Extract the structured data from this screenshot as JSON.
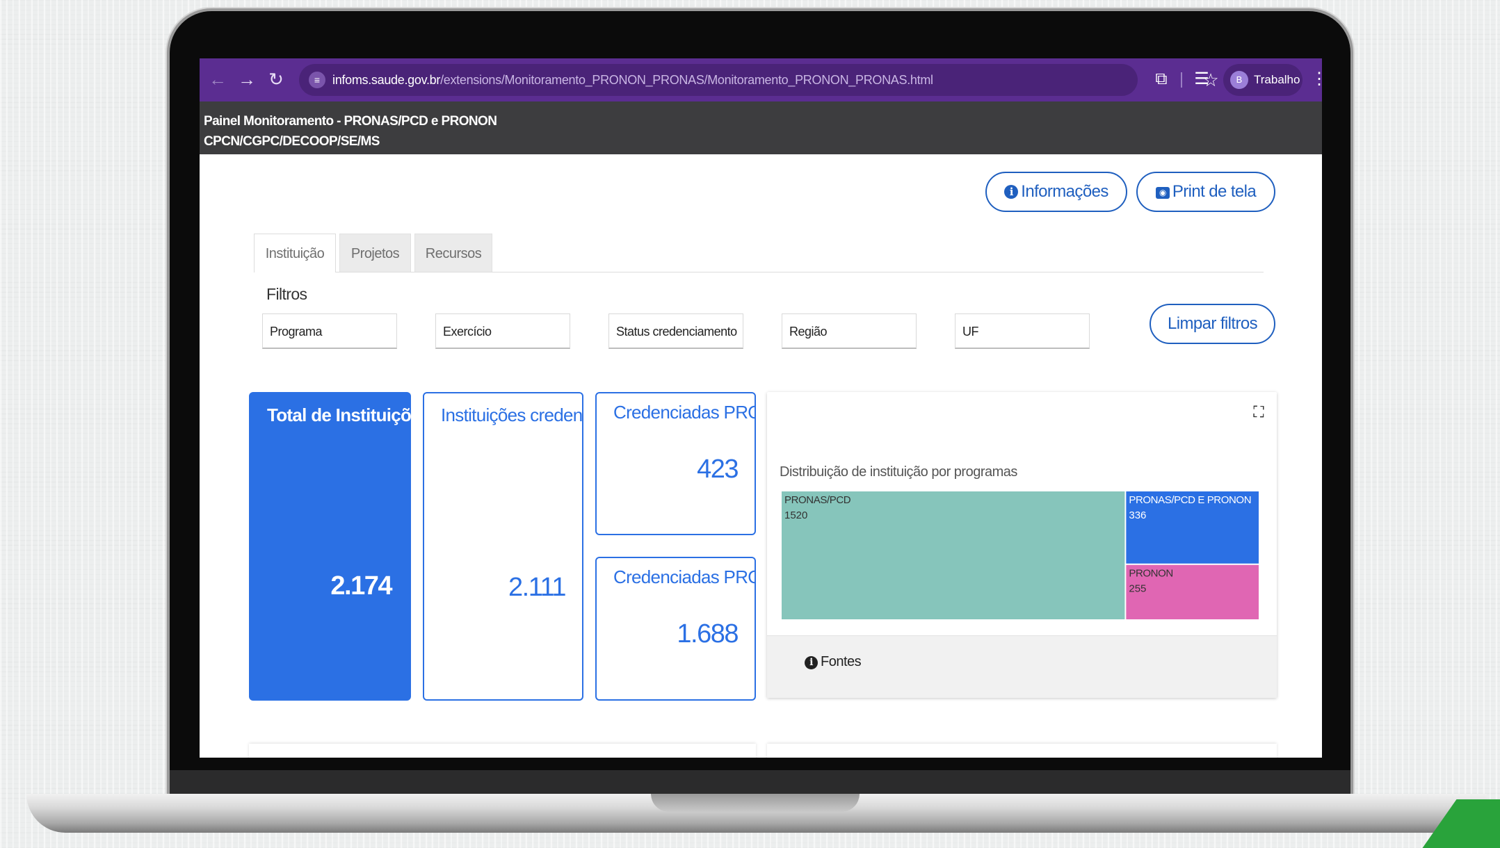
{
  "browser": {
    "url_host": "infoms.saude.gov.br",
    "url_path": "/extensions/Monitoramento_PRONON_PRONAS/Monitoramento_PRONON_PRONAS.html",
    "profile_initial": "B",
    "profile_name": "Trabalho"
  },
  "header": {
    "title": "Painel Monitoramento - PRONAS/PCD e PRONON",
    "subtitle": "CPCN/CGPC/DECOOP/SE/MS"
  },
  "toolbar": {
    "info_label": "Informações",
    "print_label": "Print de tela",
    "clear_filters_label": "Limpar filtros"
  },
  "tabs": [
    {
      "label": "Instituição",
      "active": true
    },
    {
      "label": "Projetos",
      "active": false
    },
    {
      "label": "Recursos",
      "active": false
    }
  ],
  "filters": {
    "label": "Filtros",
    "items": [
      "Programa",
      "Exercício",
      "Status credenciamento",
      "Região",
      "UF"
    ]
  },
  "kpis": {
    "total": {
      "title": "Total de Instituições",
      "value": "2.174"
    },
    "credenciadas": {
      "title": "Instituições credenciadas",
      "value": "2.111"
    },
    "pronon": {
      "title": "Credenciadas PRONON",
      "value": "423"
    },
    "pronas": {
      "title": "Credenciadas PRONAS/PCD",
      "value": "1.688"
    }
  },
  "chart": {
    "fontes_label": "Fontes"
  },
  "chart_data": {
    "type": "treemap",
    "title": "Distribuição de instituição por programas",
    "items": [
      {
        "label": "PRONAS/PCD",
        "value": 1520,
        "color": "#86c5bb"
      },
      {
        "label": "PRONAS/PCD E PRONON",
        "value": 336,
        "color": "#2b70e4"
      },
      {
        "label": "PRONON",
        "value": 255,
        "color": "#e066b3"
      }
    ]
  },
  "colors": {
    "browser_bar": "#5b2d91",
    "app_header": "#3d3d3f",
    "accent": "#2b70e4"
  }
}
